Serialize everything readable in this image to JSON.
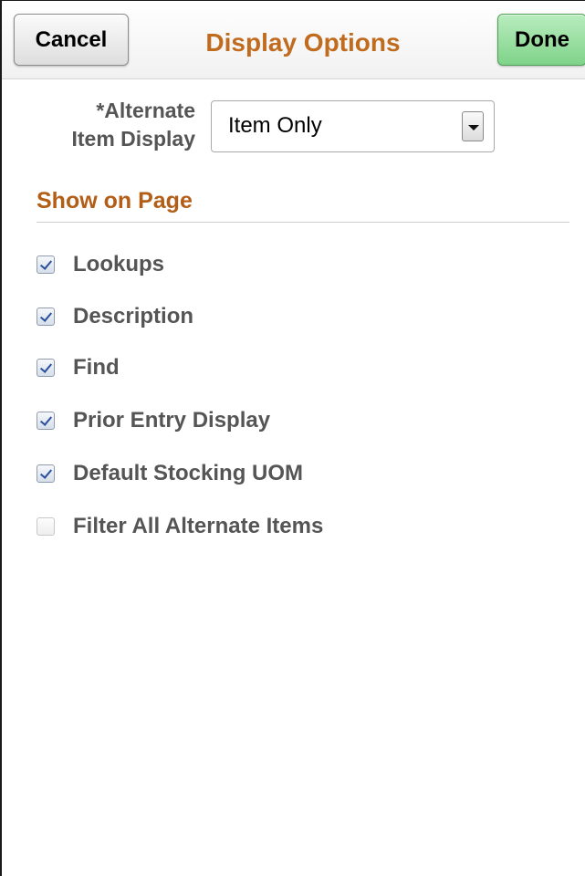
{
  "header": {
    "cancel_label": "Cancel",
    "title": "Display Options",
    "done_label": "Done"
  },
  "alternate_item_display": {
    "label_line1": "*Alternate",
    "label_line2": "Item Display",
    "selected_value": "Item Only",
    "required": true
  },
  "show_on_page": {
    "title": "Show on Page",
    "options": [
      {
        "label": "Lookups",
        "checked": true
      },
      {
        "label": "Description",
        "checked": true
      },
      {
        "label": "Find",
        "checked": true
      },
      {
        "label": "Prior Entry Display",
        "checked": true
      },
      {
        "label": "Default Stocking UOM",
        "checked": true
      },
      {
        "label": "Filter All Alternate Items",
        "checked": false
      }
    ]
  },
  "colors": {
    "title": "#c06b1e",
    "section_title": "#b25e17",
    "done_button": "#7fd389",
    "label_text": "#555555"
  },
  "icons": {
    "select_arrow": "caret-down-icon",
    "checked": "checkmark-icon"
  }
}
